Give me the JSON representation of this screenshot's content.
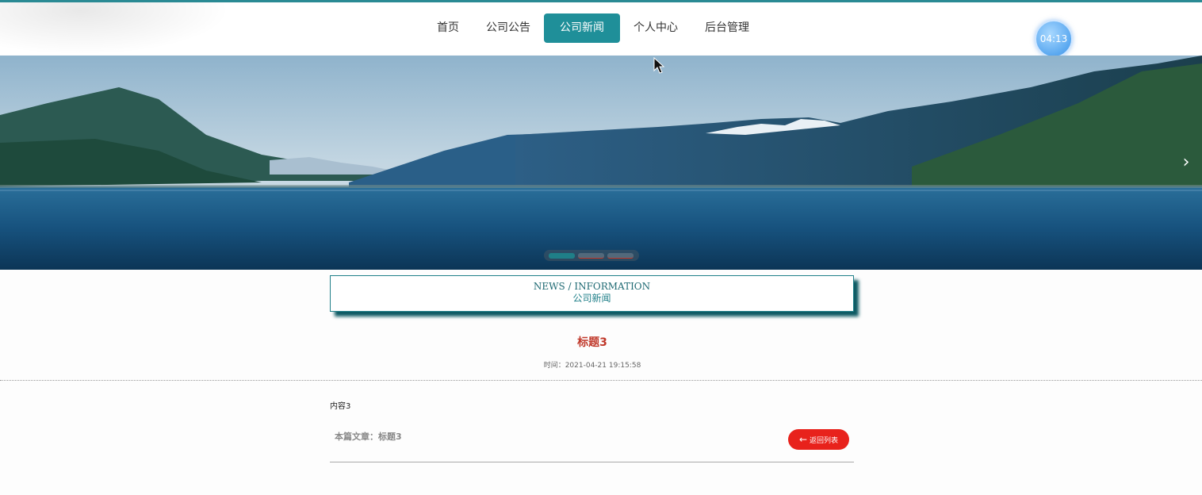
{
  "nav": {
    "items": [
      {
        "label": "首页",
        "active": false
      },
      {
        "label": "公司公告",
        "active": false
      },
      {
        "label": "公司新闻",
        "active": true
      },
      {
        "label": "个人中心",
        "active": false
      },
      {
        "label": "后台管理",
        "active": false
      }
    ]
  },
  "timer": {
    "text": "04:13"
  },
  "banner": {
    "next_icon": "chevron-right-icon",
    "slides": 3,
    "active_slide": 1
  },
  "section": {
    "en": "NEWS / INFORMATION",
    "cn": "公司新闻"
  },
  "article": {
    "title": "标题3",
    "time": "时间：2021-04-21 19:15:58",
    "content": "内容3",
    "current": "本篇文章：标题3",
    "back_label": "返回列表"
  },
  "colors": {
    "accent": "#1f8f99",
    "title_red": "#c0392b",
    "back_button": "#e8221c"
  }
}
